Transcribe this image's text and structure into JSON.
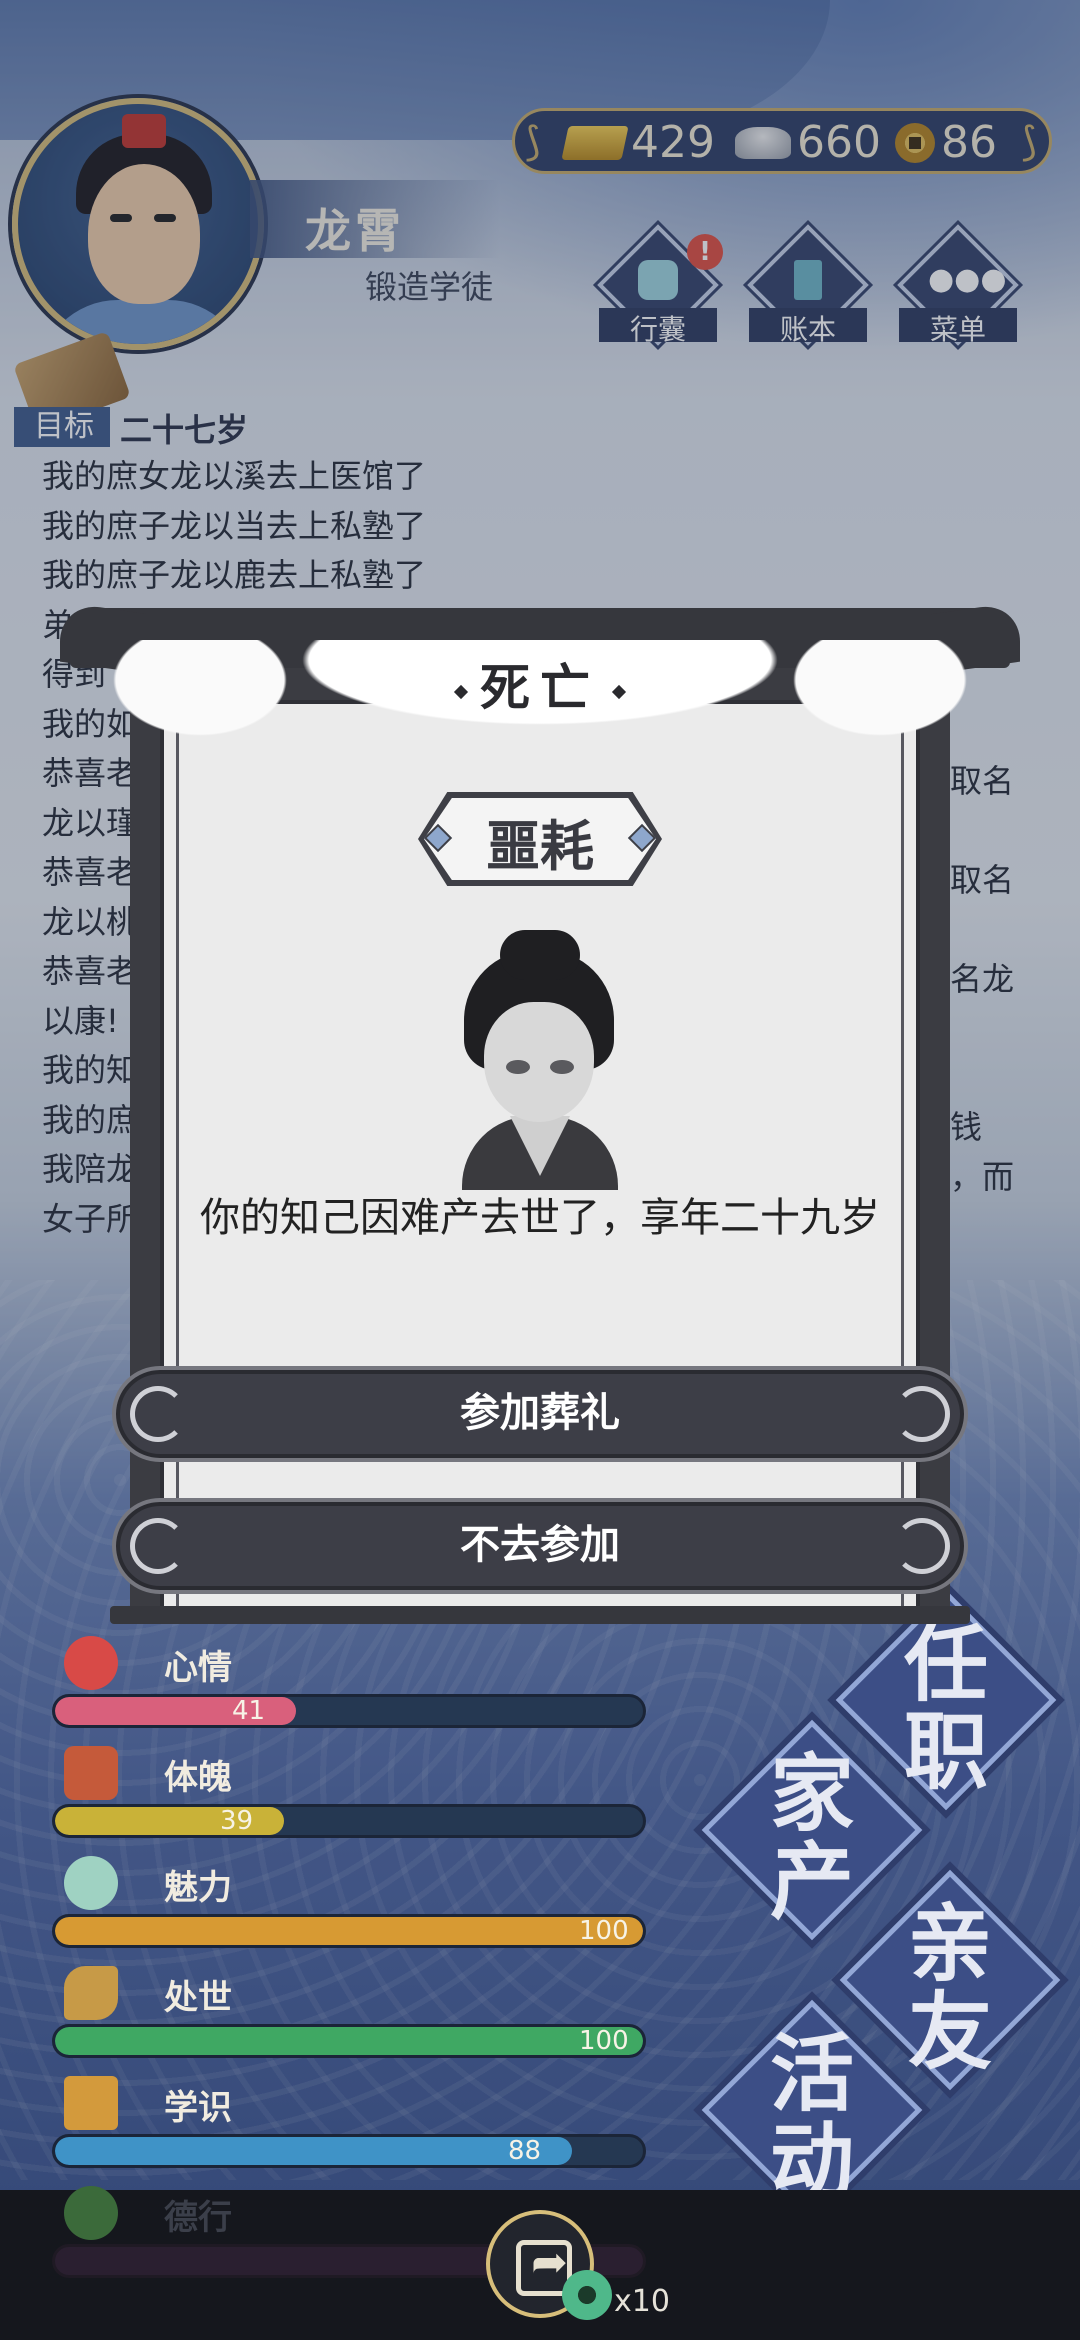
{
  "player": {
    "name": "龙霄",
    "title": "锻造学徒"
  },
  "currency": {
    "gold": "429",
    "silver": "660",
    "coins": "86"
  },
  "top_buttons": [
    {
      "label": "行囊",
      "badge": "!"
    },
    {
      "label": "账本"
    },
    {
      "label": "菜单"
    }
  ],
  "goal": {
    "tag": "目标",
    "text": "二十七岁"
  },
  "log": [
    "我的庶女龙以溪去上医馆了",
    "我的庶子龙以当去上私塾了",
    "我的庶子龙以鹿去上私塾了",
    "弟弟",
    "得到",
    "我的如",
    "恭喜老",
    "龙以瑾",
    "恭喜老",
    "龙以桃",
    "恭喜老",
    "以康!",
    "我的知",
    "我的庶",
    "我陪龙",
    "女子所"
  ],
  "log_right": [
    "取名",
    "取名",
    "名龙",
    "钱",
    "，而"
  ],
  "stats": [
    {
      "label": "心情",
      "value": "41",
      "fraction": 0.41,
      "color": "#d9607c"
    },
    {
      "label": "体魄",
      "value": "39",
      "fraction": 0.39,
      "color": "#c9b238"
    },
    {
      "label": "魅力",
      "value": "100",
      "fraction": 1.0,
      "color": "#d79a33"
    },
    {
      "label": "处世",
      "value": "100",
      "fraction": 1.0,
      "color": "#3fa863"
    },
    {
      "label": "学识",
      "value": "88",
      "fraction": 0.88,
      "color": "#3f93c7"
    },
    {
      "label": "德行",
      "value": "",
      "fraction": 0.0,
      "color": "#8a3bb0"
    }
  ],
  "big_buttons": [
    "任职",
    "家产",
    "亲友",
    "活动"
  ],
  "bottom": {
    "count": "x10"
  },
  "modal": {
    "title": "死亡",
    "tag": "噩耗",
    "message": "你的知己因难产去世了，享年二十九岁",
    "primary": "参加葬礼",
    "secondary": "不去参加"
  }
}
